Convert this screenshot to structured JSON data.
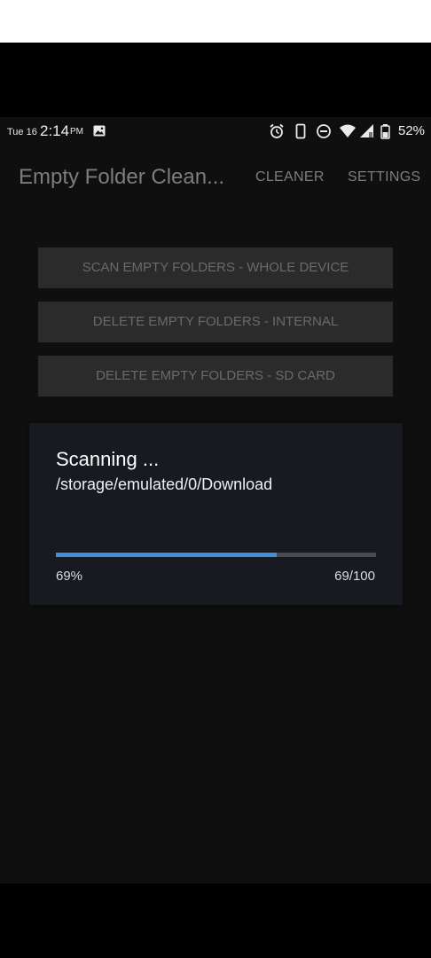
{
  "status_bar": {
    "date": "Tue 16",
    "time": "2:14",
    "ampm": "PM",
    "battery_percent": "52%",
    "icons": [
      "image-icon",
      "alarm-icon",
      "vibrate-icon",
      "do-not-disturb-icon",
      "wifi-icon",
      "signal-icon",
      "battery-icon"
    ]
  },
  "app_bar": {
    "title": "Empty Folder Clean...",
    "tabs": [
      "CLEANER",
      "SETTINGS"
    ]
  },
  "actions": [
    {
      "label": "SCAN EMPTY FOLDERS - WHOLE DEVICE"
    },
    {
      "label": "DELETE EMPTY FOLDERS - INTERNAL"
    },
    {
      "label": "DELETE EMPTY FOLDERS - SD CARD"
    }
  ],
  "progress_dialog": {
    "title": "Scanning ...",
    "path": "/storage/emulated/0/Download",
    "percent_label": "69%",
    "count_label": "69/100",
    "progress": 0.69
  },
  "colors": {
    "progress_fill": "#3f8fde",
    "progress_track": "#4a4b50",
    "dialog_bg": "#171a21",
    "button_bg": "#2b2b2b"
  }
}
